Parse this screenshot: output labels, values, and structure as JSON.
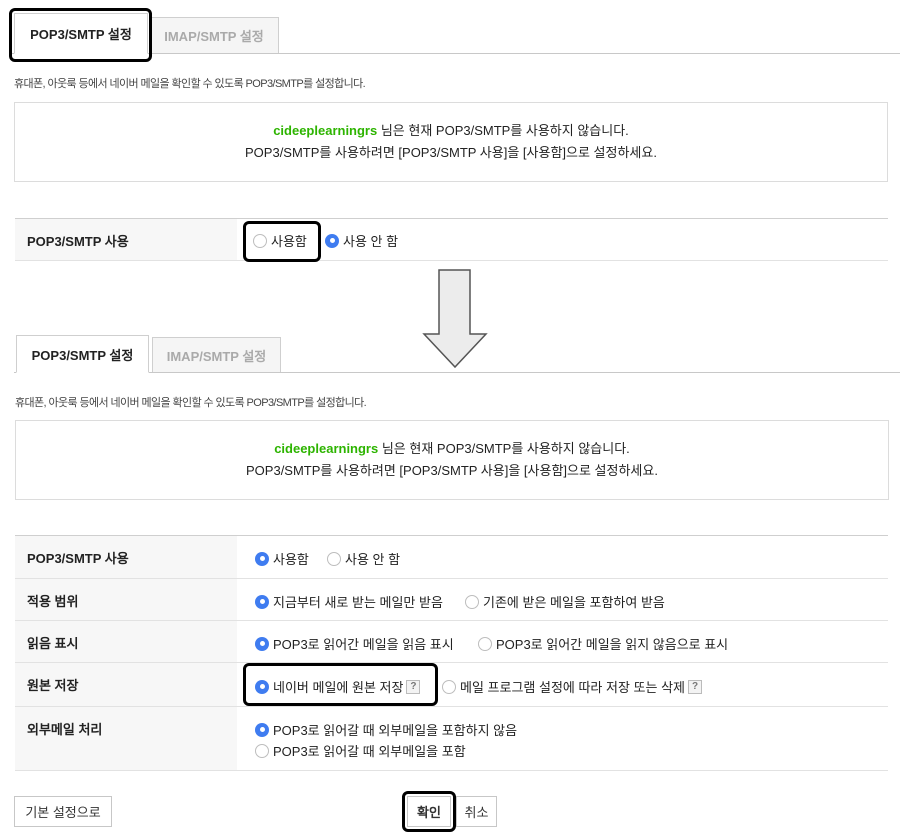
{
  "top": {
    "tabs": [
      {
        "label": "POP3/SMTP 설정"
      },
      {
        "label": "IMAP/SMTP 설정"
      }
    ],
    "description": "휴대폰, 아웃룩 등에서 네이버 메일을 확인할 수 있도록 POP3/SMTP를 설정합니다.",
    "notice": {
      "user_id": "cideeplearningrs",
      "line1_rest": " 님은 현재 POP3/SMTP를 사용하지 않습니다.",
      "line2": "POP3/SMTP를 사용하려면 [POP3/SMTP 사용]을 [사용함]으로 설정하세요."
    },
    "use_row": {
      "label": "POP3/SMTP 사용",
      "options": [
        "사용함",
        "사용 안 함"
      ],
      "selected_index": 1
    }
  },
  "bottom": {
    "tabs": [
      {
        "label": "POP3/SMTP 설정"
      },
      {
        "label": "IMAP/SMTP 설정"
      }
    ],
    "description": "휴대폰, 아웃룩 등에서 네이버 메일을 확인할 수 있도록 POP3/SMTP를 설정합니다.",
    "notice": {
      "user_id": "cideeplearningrs",
      "line1_rest": " 님은 현재 POP3/SMTP를 사용하지 않습니다.",
      "line2": "POP3/SMTP를 사용하려면 [POP3/SMTP 사용]을 [사용함]으로 설정하세요."
    },
    "rows": [
      {
        "label": "POP3/SMTP 사용",
        "options": [
          "사용함",
          "사용 안 함"
        ],
        "selected_index": 0
      },
      {
        "label": "적용 범위",
        "options": [
          "지금부터 새로 받는 메일만 받음",
          "기존에 받은 메일을 포함하여 받음"
        ],
        "selected_index": 0
      },
      {
        "label": "읽음 표시",
        "options": [
          "POP3로 읽어간 메일을 읽음 표시",
          "POP3로 읽어간 메일을 읽지 않음으로 표시"
        ],
        "selected_index": 0
      },
      {
        "label": "원본 저장",
        "options": [
          "네이버 메일에 원본 저장",
          "메일 프로그램 설정에 따라 저장 또는 삭제"
        ],
        "selected_index": 0,
        "help_icon": "question-mark-icon"
      },
      {
        "label": "외부메일 처리",
        "options": [
          "POP3로 읽어갈 때 외부메일을 포함하지 않음",
          "POP3로 읽어갈 때 외부메일을 포함"
        ],
        "selected_index": 0
      }
    ],
    "help_glyph": "?",
    "buttons": {
      "reset": "기본 설정으로",
      "confirm": "확인",
      "cancel": "취소"
    }
  },
  "colors": {
    "user_id_green": "#2db400",
    "radio_selected_blue": "#3f7cf0",
    "highlight_black": "#000000"
  },
  "icons": {
    "transition_arrow": "down-arrow-icon"
  }
}
